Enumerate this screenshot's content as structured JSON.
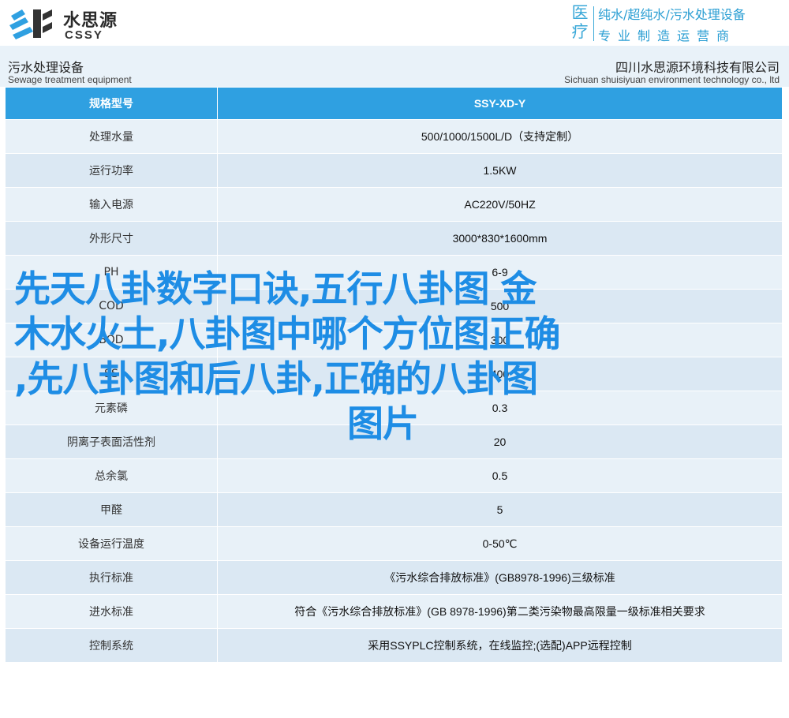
{
  "header": {
    "logo_cn": "水思源",
    "logo_en": "CSSY",
    "slogan_big": "医疗",
    "slogan_line1": "纯水/超纯水/污水处理设备",
    "slogan_line2": "专业制造运营商"
  },
  "titles": {
    "left_cn": "污水处理设备",
    "left_en": "Sewage treatment equipment",
    "right_cn": "四川水思源环境科技有限公司",
    "right_en": "Sichuan shuisiyuan environment technology co., ltd"
  },
  "table": {
    "header": {
      "label": "规格型号",
      "value": "SSY-XD-Y"
    },
    "rows": [
      {
        "label": "处理水量",
        "value": "500/1000/1500L/D（支持定制）"
      },
      {
        "label": "运行功率",
        "value": "1.5KW"
      },
      {
        "label": "输入电源",
        "value": "AC220V/50HZ"
      },
      {
        "label": "外形尺寸",
        "value": "3000*830*1600mm"
      },
      {
        "label": "PH",
        "value": "6-9"
      },
      {
        "label": "COD",
        "value": "500"
      },
      {
        "label": "BOD",
        "value": "300"
      },
      {
        "label": "SS",
        "value": "400"
      },
      {
        "label": "元素磷",
        "value": "0.3"
      },
      {
        "label": "阴离子表面活性剂",
        "value": "20"
      },
      {
        "label": "总余氯",
        "value": "0.5"
      },
      {
        "label": "甲醛",
        "value": "5"
      },
      {
        "label": "设备运行温度",
        "value": "0-50℃"
      },
      {
        "label": "执行标准",
        "value": "《污水综合排放标准》(GB8978-1996)三级标准"
      },
      {
        "label": "进水标准",
        "value": "符合《污水综合排放标准》(GB 8978-1996)第二类污染物最高限量一级标准相关要求"
      },
      {
        "label": "控制系统",
        "value": "采用SSYPLC控制系统，在线监控;(选配)APP远程控制"
      }
    ]
  },
  "overlay": {
    "line1": "先天八卦数字口诀,五行八卦图 金",
    "line2": "木水火土,八卦图中哪个方位图正确",
    "line3": ",先八卦图和后八卦,正确的八卦图",
    "line4": "图片"
  },
  "colors": {
    "accent": "#2fa0e1",
    "row_even": "#dbe8f3",
    "row_odd": "#e8f1f8",
    "overlay_text": "#1e8de5"
  }
}
